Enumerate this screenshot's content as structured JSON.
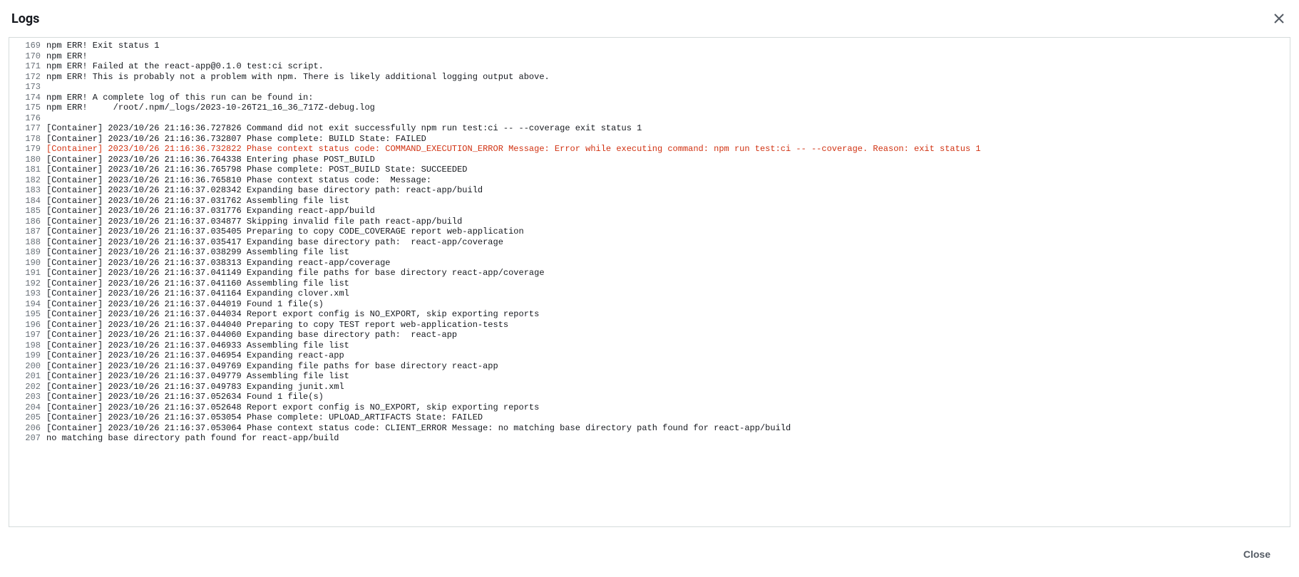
{
  "header": {
    "title": "Logs"
  },
  "footer": {
    "close_label": "Close"
  },
  "logs": [
    {
      "num": 169,
      "text": "npm ERR! Exit status 1",
      "error": false
    },
    {
      "num": 170,
      "text": "npm ERR!",
      "error": false
    },
    {
      "num": 171,
      "text": "npm ERR! Failed at the react-app@0.1.0 test:ci script.",
      "error": false
    },
    {
      "num": 172,
      "text": "npm ERR! This is probably not a problem with npm. There is likely additional logging output above.",
      "error": false
    },
    {
      "num": 173,
      "text": "",
      "error": false
    },
    {
      "num": 174,
      "text": "npm ERR! A complete log of this run can be found in:",
      "error": false
    },
    {
      "num": 175,
      "text": "npm ERR!     /root/.npm/_logs/2023-10-26T21_16_36_717Z-debug.log",
      "error": false
    },
    {
      "num": 176,
      "text": "",
      "error": false
    },
    {
      "num": 177,
      "text": "[Container] 2023/10/26 21:16:36.727826 Command did not exit successfully npm run test:ci -- --coverage exit status 1",
      "error": false
    },
    {
      "num": 178,
      "text": "[Container] 2023/10/26 21:16:36.732807 Phase complete: BUILD State: FAILED",
      "error": false
    },
    {
      "num": 179,
      "text": "[Container] 2023/10/26 21:16:36.732822 Phase context status code: COMMAND_EXECUTION_ERROR Message: Error while executing command: npm run test:ci -- --coverage. Reason: exit status 1",
      "error": true
    },
    {
      "num": 180,
      "text": "[Container] 2023/10/26 21:16:36.764338 Entering phase POST_BUILD",
      "error": false
    },
    {
      "num": 181,
      "text": "[Container] 2023/10/26 21:16:36.765798 Phase complete: POST_BUILD State: SUCCEEDED",
      "error": false
    },
    {
      "num": 182,
      "text": "[Container] 2023/10/26 21:16:36.765810 Phase context status code:  Message:",
      "error": false
    },
    {
      "num": 183,
      "text": "[Container] 2023/10/26 21:16:37.028342 Expanding base directory path: react-app/build",
      "error": false
    },
    {
      "num": 184,
      "text": "[Container] 2023/10/26 21:16:37.031762 Assembling file list",
      "error": false
    },
    {
      "num": 185,
      "text": "[Container] 2023/10/26 21:16:37.031776 Expanding react-app/build",
      "error": false
    },
    {
      "num": 186,
      "text": "[Container] 2023/10/26 21:16:37.034877 Skipping invalid file path react-app/build",
      "error": false
    },
    {
      "num": 187,
      "text": "[Container] 2023/10/26 21:16:37.035405 Preparing to copy CODE_COVERAGE report web-application",
      "error": false
    },
    {
      "num": 188,
      "text": "[Container] 2023/10/26 21:16:37.035417 Expanding base directory path:  react-app/coverage",
      "error": false
    },
    {
      "num": 189,
      "text": "[Container] 2023/10/26 21:16:37.038299 Assembling file list",
      "error": false
    },
    {
      "num": 190,
      "text": "[Container] 2023/10/26 21:16:37.038313 Expanding react-app/coverage",
      "error": false
    },
    {
      "num": 191,
      "text": "[Container] 2023/10/26 21:16:37.041149 Expanding file paths for base directory react-app/coverage",
      "error": false
    },
    {
      "num": 192,
      "text": "[Container] 2023/10/26 21:16:37.041160 Assembling file list",
      "error": false
    },
    {
      "num": 193,
      "text": "[Container] 2023/10/26 21:16:37.041164 Expanding clover.xml",
      "error": false
    },
    {
      "num": 194,
      "text": "[Container] 2023/10/26 21:16:37.044019 Found 1 file(s)",
      "error": false
    },
    {
      "num": 195,
      "text": "[Container] 2023/10/26 21:16:37.044034 Report export config is NO_EXPORT, skip exporting reports",
      "error": false
    },
    {
      "num": 196,
      "text": "[Container] 2023/10/26 21:16:37.044040 Preparing to copy TEST report web-application-tests",
      "error": false
    },
    {
      "num": 197,
      "text": "[Container] 2023/10/26 21:16:37.044060 Expanding base directory path:  react-app",
      "error": false
    },
    {
      "num": 198,
      "text": "[Container] 2023/10/26 21:16:37.046933 Assembling file list",
      "error": false
    },
    {
      "num": 199,
      "text": "[Container] 2023/10/26 21:16:37.046954 Expanding react-app",
      "error": false
    },
    {
      "num": 200,
      "text": "[Container] 2023/10/26 21:16:37.049769 Expanding file paths for base directory react-app",
      "error": false
    },
    {
      "num": 201,
      "text": "[Container] 2023/10/26 21:16:37.049779 Assembling file list",
      "error": false
    },
    {
      "num": 202,
      "text": "[Container] 2023/10/26 21:16:37.049783 Expanding junit.xml",
      "error": false
    },
    {
      "num": 203,
      "text": "[Container] 2023/10/26 21:16:37.052634 Found 1 file(s)",
      "error": false
    },
    {
      "num": 204,
      "text": "[Container] 2023/10/26 21:16:37.052648 Report export config is NO_EXPORT, skip exporting reports",
      "error": false
    },
    {
      "num": 205,
      "text": "[Container] 2023/10/26 21:16:37.053054 Phase complete: UPLOAD_ARTIFACTS State: FAILED",
      "error": false
    },
    {
      "num": 206,
      "text": "[Container] 2023/10/26 21:16:37.053064 Phase context status code: CLIENT_ERROR Message: no matching base directory path found for react-app/build",
      "error": false
    },
    {
      "num": 207,
      "text": "no matching base directory path found for react-app/build",
      "error": false
    }
  ]
}
